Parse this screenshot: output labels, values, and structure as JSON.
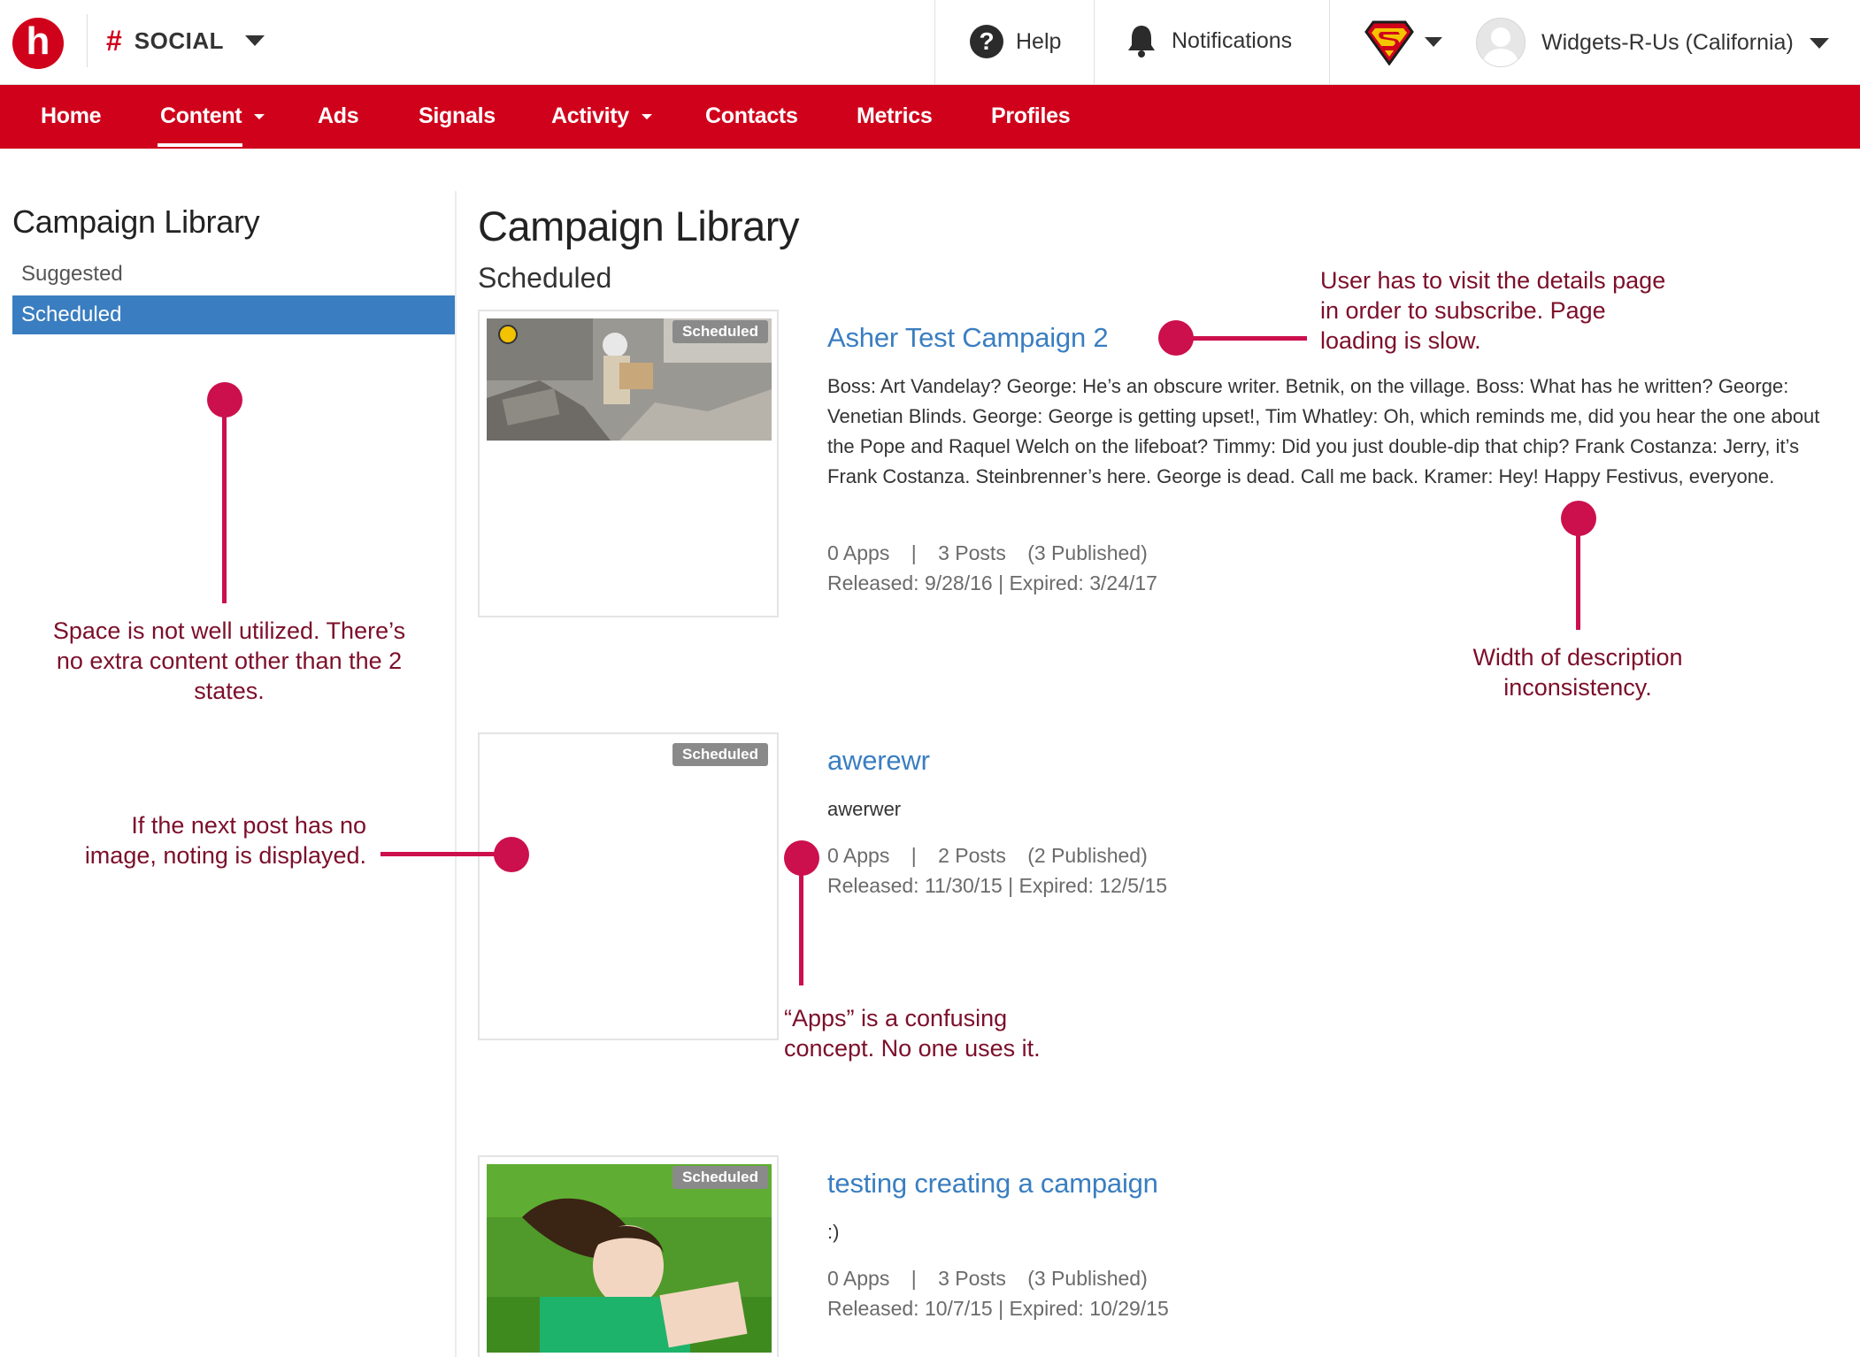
{
  "header": {
    "logo_letter": "h",
    "hash": "#",
    "product": "SOCIAL",
    "help": "Help",
    "notifications": "Notifications",
    "org": "Widgets-R-Us (California)"
  },
  "nav": {
    "items": [
      {
        "label": "Home"
      },
      {
        "label": "Content"
      },
      {
        "label": "Ads"
      },
      {
        "label": "Signals"
      },
      {
        "label": "Activity"
      },
      {
        "label": "Contacts"
      },
      {
        "label": "Metrics"
      },
      {
        "label": "Profiles"
      }
    ]
  },
  "sidebar": {
    "title": "Campaign Library",
    "items": [
      {
        "label": "Suggested"
      },
      {
        "label": "Scheduled"
      }
    ]
  },
  "main": {
    "title": "Campaign Library",
    "subtitle": "Scheduled",
    "campaigns": [
      {
        "badge": "Scheduled",
        "title": "Asher Test Campaign 2",
        "description": "Boss: Art Vandelay? George: He’s an obscure writer. Betnik, on the village. Boss: What has he written? George: Venetian Blinds. George: George is getting upset!, Tim Whatley: Oh, which reminds me, did you hear the one about the Pope and Raquel Welch on the lifeboat? Timmy: Did you just double-dip that chip? Frank Costanza: Jerry, it’s Frank Costanza. Steinbrenner’s here. George is dead. Call me back. Kramer: Hey! Happy Festivus, everyone.",
        "apps": "0 Apps",
        "sep": "|",
        "posts": "3 Posts",
        "published": "(3 Published)",
        "dates": "Released: 9/28/16 | Expired: 3/24/17"
      },
      {
        "badge": "Scheduled",
        "title": "awerewr",
        "description": "awerwer",
        "apps": "0 Apps",
        "sep": "|",
        "posts": "2 Posts",
        "published": "(2 Published)",
        "dates": "Released: 11/30/15 | Expired: 12/5/15"
      },
      {
        "badge": "Scheduled",
        "title": "testing creating a campaign",
        "description": ":)",
        "apps": "0 Apps",
        "sep": "|",
        "posts": "3 Posts",
        "published": "(3 Published)",
        "dates": "Released: 10/7/15 | Expired: 10/29/15"
      }
    ]
  },
  "annotations": {
    "subscribe": "User has to visit the details page in order to subscribe. Page loading is slow.",
    "space": "Space is not well utilized. There’s no extra content other than the 2 states.",
    "width": "Width of description inconsistency.",
    "no_image": "If the next post has no image, noting is displayed.",
    "apps": "“Apps” is a confusing concept. No one uses it."
  },
  "colors": {
    "brand_red": "#d0021b",
    "link_blue": "#3a7ec1",
    "annotation": "#cc0f4d"
  }
}
